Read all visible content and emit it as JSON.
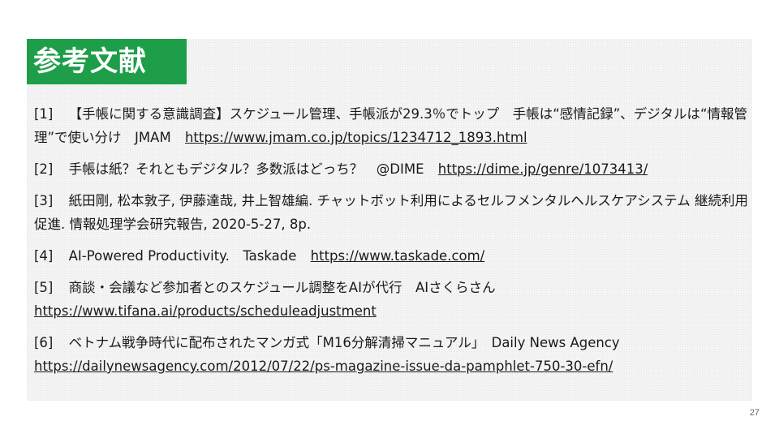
{
  "slide": {
    "title": "参考文献",
    "page_number": "27",
    "colors": {
      "title_bg": "#1e9e49",
      "title_text": "#ffffff",
      "panel_bg": "#f4f4f4"
    }
  },
  "references": [
    {
      "num": "[1]",
      "text": "【手帳に関する意識調査】スケジュール管理、手帳派が29.3％でトップ　手帳は“感情記録”、デジタルは“情報管理”で使い分け　JMAM",
      "url": "https://www.jmam.co.jp/topics/1234712_1893.html"
    },
    {
      "num": "[2]",
      "text": "手帳は紙？それともデジタル？多数派はどっち？　@DIME",
      "url": "https://dime.jp/genre/1073413/"
    },
    {
      "num": "[3]",
      "text": "紙田剛, 松本敦子, 伊藤達哉, 井上智雄編. チャットボット利用によるセルフメンタルヘルスケアシステム 継続利用促進. 情報処理学会研究報告, 2020-5-27, 8p.",
      "url": ""
    },
    {
      "num": "[4]",
      "text": "AI-Powered Productivity.　Taskade",
      "url": "https://www.taskade.com/"
    },
    {
      "num": "[5]",
      "text": "商談・会議など参加者とのスケジュール調整をAIが代行　AIさくらさん",
      "url": "https://www.tifana.ai/products/scheduleadjustment"
    },
    {
      "num": "[6]",
      "text": "ベトナム戦争時代に配布されたマンガ式「M16分解清掃マニュアル」　Daily News Agency",
      "url": "https://dailynewsagency.com/2012/07/22/ps-magazine-issue-da-pamphlet-750-30-efn/"
    }
  ]
}
